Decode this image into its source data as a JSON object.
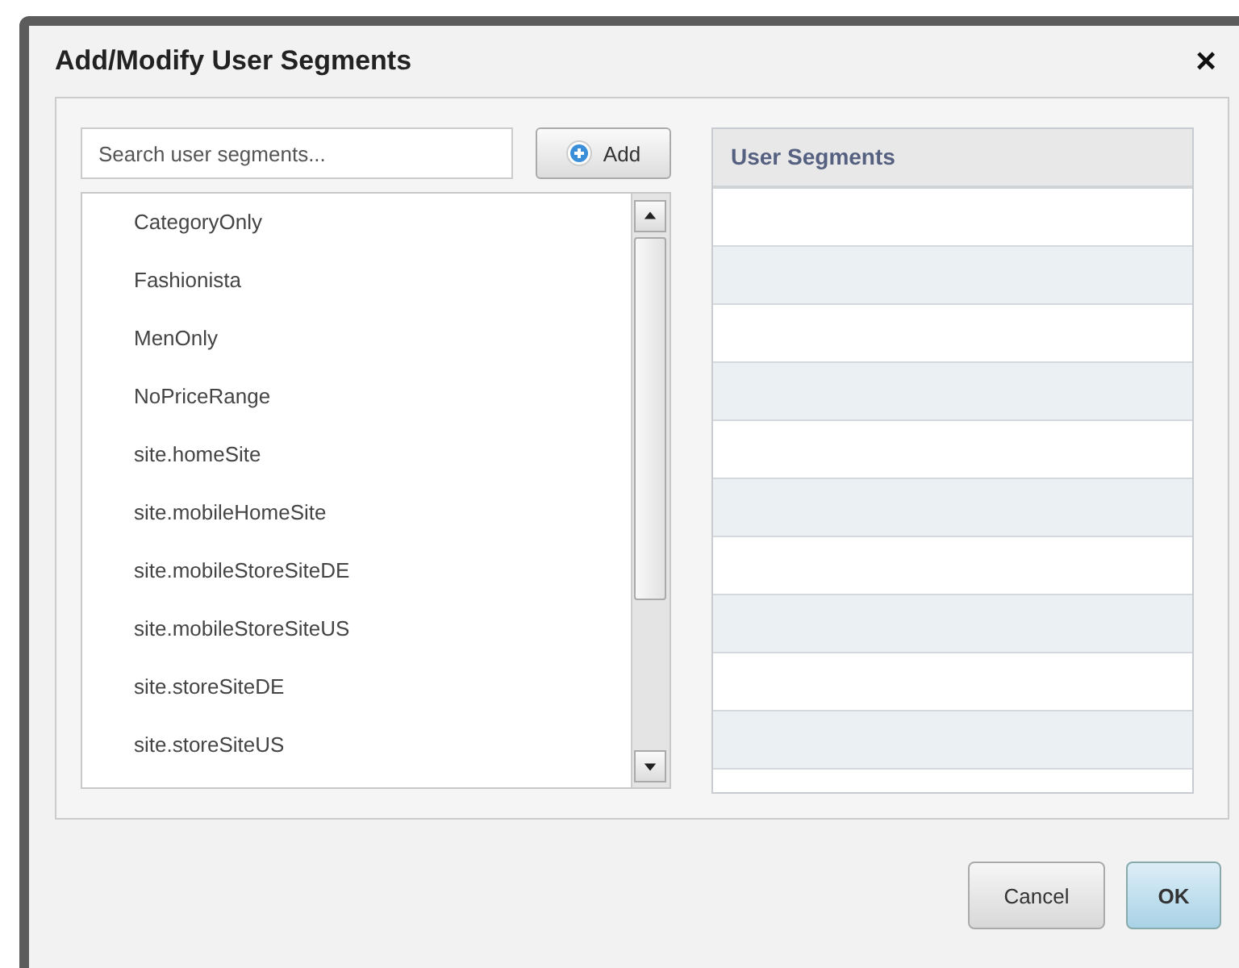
{
  "dialog": {
    "title": "Add/Modify User Segments",
    "close": "×"
  },
  "search": {
    "placeholder": "Search user segments..."
  },
  "add_button": {
    "label": "Add"
  },
  "available_segments": [
    {
      "label": "CategoryOnly"
    },
    {
      "label": "Fashionista"
    },
    {
      "label": "MenOnly"
    },
    {
      "label": "NoPriceRange"
    },
    {
      "label": "site.homeSite"
    },
    {
      "label": "site.mobileHomeSite"
    },
    {
      "label": "site.mobileStoreSiteDE"
    },
    {
      "label": "site.mobileStoreSiteUS"
    },
    {
      "label": "site.storeSiteDE"
    },
    {
      "label": "site.storeSiteUS"
    }
  ],
  "selected_table": {
    "column": "User Segments"
  },
  "buttons": [
    {
      "label": "Cancel",
      "kind": "secondary"
    },
    {
      "label": "OK",
      "kind": "primary"
    }
  ]
}
